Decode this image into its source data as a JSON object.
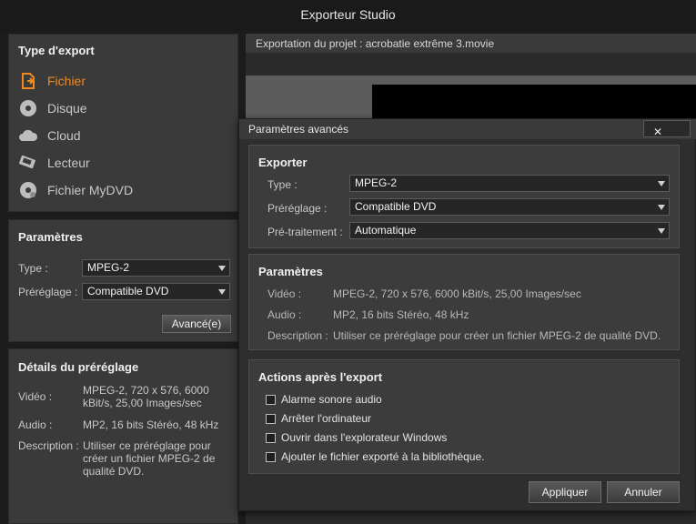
{
  "app": {
    "title": "Exporteur Studio"
  },
  "export_type": {
    "heading": "Type d'export",
    "items": [
      {
        "label": "Fichier",
        "icon": "file-export-icon"
      },
      {
        "label": "Disque",
        "icon": "disc-icon"
      },
      {
        "label": "Cloud",
        "icon": "cloud-icon"
      },
      {
        "label": "Lecteur",
        "icon": "device-icon"
      },
      {
        "label": "Fichier MyDVD",
        "icon": "mydvd-icon"
      }
    ],
    "active": "Fichier",
    "accent": "#f08a1e"
  },
  "params": {
    "heading": "Paramètres",
    "type_label": "Type :",
    "type_value": "MPEG-2",
    "preset_label": "Préréglage :",
    "preset_value": "Compatible DVD",
    "advanced_button": "Avancé(e)"
  },
  "details": {
    "heading": "Détails du préréglage",
    "video_label": "Vidéo :",
    "video_line1": "MPEG-2, 720 x 576, 6000",
    "video_line2": "kBit/s, 25,00 Images/sec",
    "audio_label": "Audio :",
    "audio_value": "MP2, 16 bits Stéréo, 48 kHz",
    "desc_label": "Description :",
    "desc_line1": "Utiliser ce préréglage pour",
    "desc_line2": "créer un fichier MPEG-2 de",
    "desc_line3": "qualité DVD."
  },
  "project": {
    "label": "Exportation du projet : acrobatie extrême 3.movie"
  },
  "dialog": {
    "title": "Paramètres avancés",
    "close": "✕",
    "export": {
      "heading": "Exporter",
      "type_label": "Type :",
      "type_value": "MPEG-2",
      "preset_label": "Préréglage :",
      "preset_value": "Compatible DVD",
      "pre_label": "Pré-traitement :",
      "pre_value": "Automatique"
    },
    "params": {
      "heading": "Paramètres",
      "video_label": "Vidéo :",
      "video_value": "MPEG-2, 720 x 576, 6000 kBit/s, 25,00 Images/sec",
      "audio_label": "Audio :",
      "audio_value": "MP2, 16 bits Stéréo, 48 kHz",
      "desc_label": "Description :",
      "desc_value": "Utiliser ce préréglage pour créer un fichier MPEG-2 de qualité DVD."
    },
    "actions": {
      "heading": "Actions après l'export",
      "items": [
        {
          "label": "Alarme sonore audio",
          "checked": false
        },
        {
          "label": "Arrêter l'ordinateur",
          "checked": false
        },
        {
          "label": "Ouvrir dans l'explorateur Windows",
          "checked": false
        },
        {
          "label": "Ajouter le fichier exporté à la bibliothèque.",
          "checked": false
        }
      ]
    },
    "apply_button": "Appliquer",
    "cancel_button": "Annuler"
  }
}
